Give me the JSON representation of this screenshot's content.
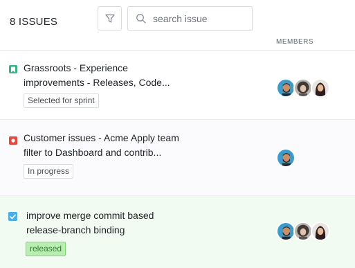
{
  "header": {
    "issue_count": "8 ISSUES",
    "search_placeholder": "search issue",
    "members_label": "MEMBERS"
  },
  "colors": {
    "story": "#36b37e",
    "bug": "#e5493a",
    "task": "#4bade8",
    "released_bg": "#b8efb0"
  },
  "issues": [
    {
      "type": "story-icon",
      "title_line1": "Grassroots - Experience",
      "title_line2": "improvements - Releases, Code...",
      "status": "Selected for sprint",
      "members": [
        "avatar-bearded-man",
        "avatar-curly-woman",
        "avatar-woman-long-hair"
      ]
    },
    {
      "type": "bug-icon",
      "title_line1": "Customer issues - Acme Apply team",
      "title_line2": "filter to Dashboard and contrib...",
      "status": "In progress",
      "members": [
        "avatar-bearded-man"
      ]
    },
    {
      "type": "task-icon",
      "title_line1": "improve merge commit based",
      "title_line2": "release-branch binding",
      "status": "released",
      "members": [
        "avatar-bearded-man",
        "avatar-curly-woman",
        "avatar-woman-long-hair"
      ]
    }
  ]
}
